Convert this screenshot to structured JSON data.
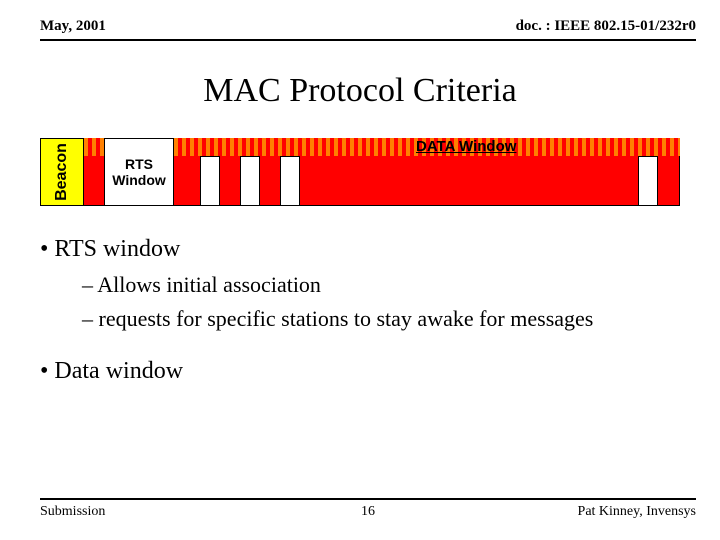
{
  "header": {
    "date": "May, 2001",
    "doc": "doc. : IEEE 802.15-01/232r0"
  },
  "title": "MAC Protocol Criteria",
  "diagram": {
    "beacon_label": "Beacon",
    "rts_label": "RTS\nWindow",
    "data_label": "DATA Window"
  },
  "bullets": {
    "b1": "• RTS window",
    "b1_sub1": "– Allows initial association",
    "b1_sub2": "– requests for specific stations to stay awake for messages",
    "b2": "• Data window"
  },
  "footer": {
    "left": "Submission",
    "center": "16",
    "right": "Pat Kinney, Invensys"
  }
}
